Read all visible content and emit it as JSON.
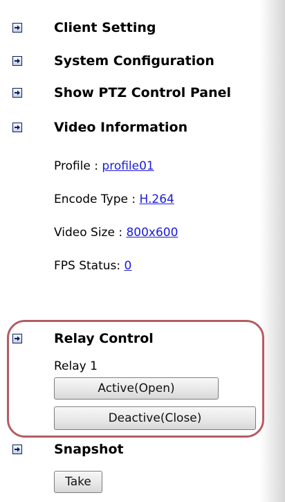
{
  "menu": {
    "client_setting": "Client Setting",
    "system_configuration": "System Configuration",
    "ptz_panel": "Show PTZ Control Panel",
    "video_information": "Video Information"
  },
  "video_info": {
    "profile_label": "Profile : ",
    "profile_value": "profile01",
    "encode_label": "Encode Type : ",
    "encode_value": "H.264",
    "size_label": "Video Size : ",
    "size_value": "800x600",
    "fps_label": "FPS Status: ",
    "fps_value": "0"
  },
  "relay": {
    "title": "Relay Control",
    "relay_label": "Relay 1",
    "active_button": "Active(Open)",
    "deactive_button": "Deactive(Close)"
  },
  "snapshot": {
    "title": "Snapshot",
    "take_button": "Take"
  },
  "icons": {
    "nav_arrow": "arrow-right-icon"
  },
  "colors": {
    "link": "#1a1ae0",
    "highlight_border": "#b55b63",
    "icon_border": "#0a1d5a"
  }
}
